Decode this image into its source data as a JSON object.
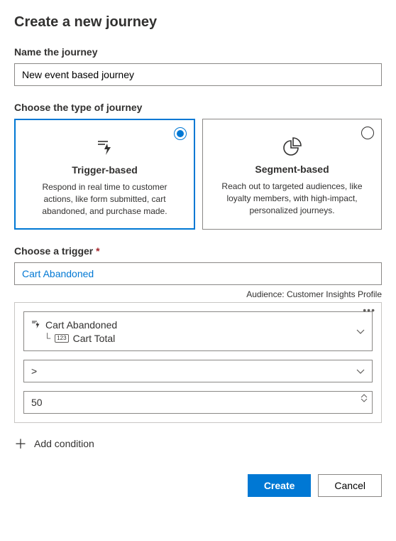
{
  "title": "Create a new journey",
  "name_field": {
    "label": "Name the journey",
    "value": "New event based journey"
  },
  "type_field": {
    "label": "Choose the type of journey",
    "options": [
      {
        "title": "Trigger-based",
        "desc": "Respond in real time to customer actions, like form submitted, cart abandoned, and purchase made.",
        "selected": true
      },
      {
        "title": "Segment-based",
        "desc": "Reach out to targeted audiences, like loyalty members, with high-impact, personalized journeys.",
        "selected": false
      }
    ]
  },
  "trigger_field": {
    "label": "Choose a trigger",
    "value": "Cart Abandoned"
  },
  "audience": {
    "label": "Audience:",
    "value": "Customer Insights Profile"
  },
  "condition": {
    "field_root": "Cart Abandoned",
    "field_child": "Cart Total",
    "operator": ">",
    "value": "50"
  },
  "add_condition_label": "Add condition",
  "buttons": {
    "create": "Create",
    "cancel": "Cancel"
  }
}
